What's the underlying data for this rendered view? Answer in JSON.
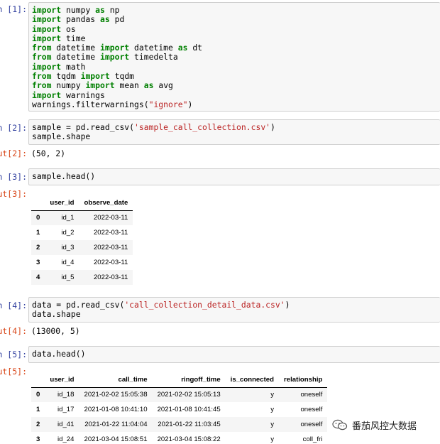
{
  "cells": [
    {
      "in_prompt": "In [1]:",
      "lines": [
        [
          [
            "kw",
            "import"
          ],
          [
            "plain",
            " numpy "
          ],
          [
            "kw",
            "as"
          ],
          [
            "plain",
            " np"
          ]
        ],
        [
          [
            "kw",
            "import"
          ],
          [
            "plain",
            " pandas "
          ],
          [
            "kw",
            "as"
          ],
          [
            "plain",
            " pd"
          ]
        ],
        [
          [
            "kw",
            "import"
          ],
          [
            "plain",
            " os"
          ]
        ],
        [
          [
            "kw",
            "import"
          ],
          [
            "plain",
            " time"
          ]
        ],
        [
          [
            "kw",
            "from"
          ],
          [
            "plain",
            " datetime "
          ],
          [
            "kw",
            "import"
          ],
          [
            "plain",
            " datetime "
          ],
          [
            "kw",
            "as"
          ],
          [
            "plain",
            " dt"
          ]
        ],
        [
          [
            "kw",
            "from"
          ],
          [
            "plain",
            " datetime "
          ],
          [
            "kw",
            "import"
          ],
          [
            "plain",
            " timedelta"
          ]
        ],
        [
          [
            "kw",
            "import"
          ],
          [
            "plain",
            " math"
          ]
        ],
        [
          [
            "kw",
            "from"
          ],
          [
            "plain",
            " tqdm "
          ],
          [
            "kw",
            "import"
          ],
          [
            "plain",
            " tqdm"
          ]
        ],
        [
          [
            "kw",
            "from"
          ],
          [
            "plain",
            " numpy "
          ],
          [
            "kw",
            "import"
          ],
          [
            "plain",
            " mean "
          ],
          [
            "kw",
            "as"
          ],
          [
            "plain",
            " avg"
          ]
        ],
        [
          [
            "kw",
            "import"
          ],
          [
            "plain",
            " warnings"
          ]
        ],
        [
          [
            "plain",
            "warnings.filterwarnings("
          ],
          [
            "str",
            "\"ignore\""
          ],
          [
            "plain",
            ")"
          ]
        ]
      ]
    },
    {
      "in_prompt": "In [2]:",
      "lines": [
        [
          [
            "plain",
            "sample = pd.read_csv("
          ],
          [
            "str",
            "'sample_call_collection.csv'"
          ],
          [
            "plain",
            ")"
          ]
        ],
        [
          [
            "plain",
            "sample.shape"
          ]
        ]
      ],
      "out_prompt": "Out[2]:",
      "out_text": "(50, 2)"
    },
    {
      "in_prompt": "In [3]:",
      "lines": [
        [
          [
            "plain",
            "sample.head()"
          ]
        ]
      ],
      "out_prompt": "Out[3]:",
      "table": {
        "columns": [
          "user_id",
          "observe_date"
        ],
        "rows": [
          {
            "index": "0",
            "values": [
              "id_1",
              "2022-03-11"
            ]
          },
          {
            "index": "1",
            "values": [
              "id_2",
              "2022-03-11"
            ]
          },
          {
            "index": "2",
            "values": [
              "id_3",
              "2022-03-11"
            ]
          },
          {
            "index": "3",
            "values": [
              "id_4",
              "2022-03-11"
            ]
          },
          {
            "index": "4",
            "values": [
              "id_5",
              "2022-03-11"
            ]
          }
        ]
      }
    },
    {
      "in_prompt": "In [4]:",
      "lines": [
        [
          [
            "plain",
            "data = pd.read_csv("
          ],
          [
            "str",
            "'call_collection_detail_data.csv'"
          ],
          [
            "plain",
            ")"
          ]
        ],
        [
          [
            "plain",
            "data.shape"
          ]
        ]
      ],
      "out_prompt": "Out[4]:",
      "out_text": "(13000, 5)"
    },
    {
      "in_prompt": "In [5]:",
      "lines": [
        [
          [
            "plain",
            "data.head()"
          ]
        ]
      ],
      "out_prompt": "Out[5]:",
      "table": {
        "columns": [
          "user_id",
          "call_time",
          "ringoff_time",
          "is_connected",
          "relationship"
        ],
        "rows": [
          {
            "index": "0",
            "values": [
              "id_18",
              "2021-02-02 15:05:38",
              "2021-02-02 15:05:13",
              "y",
              "oneself"
            ]
          },
          {
            "index": "1",
            "values": [
              "id_17",
              "2021-01-08 10:41:10",
              "2021-01-08 10:41:45",
              "y",
              "oneself"
            ]
          },
          {
            "index": "2",
            "values": [
              "id_41",
              "2021-01-22 11:04:04",
              "2021-01-22 11:03:45",
              "y",
              "oneself"
            ]
          },
          {
            "index": "3",
            "values": [
              "id_24",
              "2021-03-04 15:08:51",
              "2021-03-04 15:08:22",
              "y",
              "coll_fri"
            ]
          }
        ]
      }
    }
  ],
  "watermark": {
    "icon": "wechat-icon",
    "text": "番茄风控大数据"
  }
}
